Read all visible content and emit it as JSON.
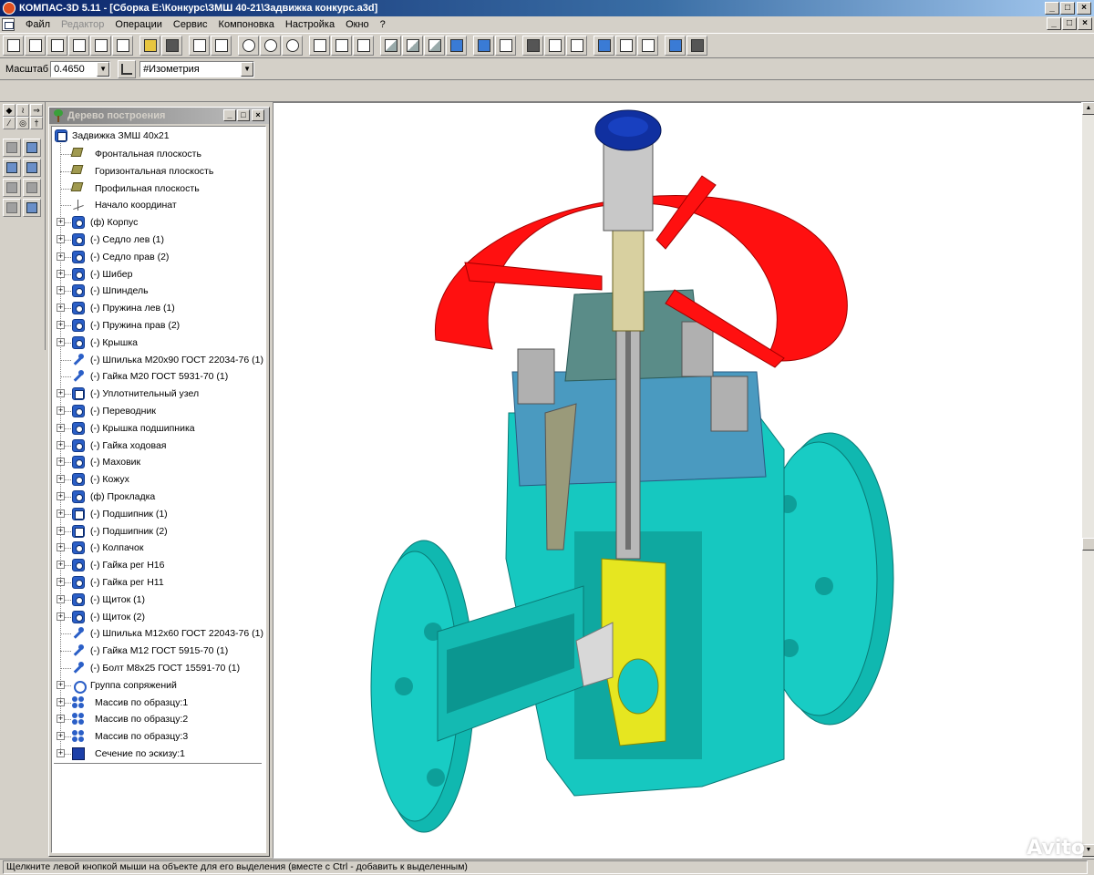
{
  "window": {
    "title": "КОМПАС-3D 5.11 - [Сборка E:\\Конкурс\\ЗМШ 40-21\\Задвижка конкурс.a3d]",
    "buttons": {
      "minimize": "_",
      "maximize": "□",
      "close": "×"
    }
  },
  "menu": {
    "items": [
      {
        "label": "Файл",
        "disabled": false
      },
      {
        "label": "Редактор",
        "disabled": true
      },
      {
        "label": "Операции",
        "disabled": false
      },
      {
        "label": "Сервис",
        "disabled": false
      },
      {
        "label": "Компоновка",
        "disabled": false
      },
      {
        "label": "Настройка",
        "disabled": false
      },
      {
        "label": "Окно",
        "disabled": false
      },
      {
        "label": "?",
        "disabled": false
      }
    ]
  },
  "toolbar": {
    "groups": [
      [
        "new-assembly-icon",
        "new-part-icon",
        "new-document-icon",
        "new-sheet-icon",
        "new-text-icon",
        "new-spec-icon"
      ],
      [
        "open-icon",
        "save-icon"
      ],
      [
        "cut-icon",
        "paste-icon"
      ],
      [
        "zoom-icon",
        "zoom-in-icon",
        "zoom-out-icon"
      ],
      [
        "pan-icon",
        "zoom-fit-icon",
        "rotate-icon"
      ],
      [
        "wireframe-icon",
        "hidden-lines-icon",
        "hidden-removed-icon",
        "shaded-icon"
      ],
      [
        "perspective-icon",
        "model-settings-icon"
      ],
      [
        "measure-icon",
        "sketch-icon",
        "section-view-icon"
      ],
      [
        "calculator-icon",
        "preview-icon",
        "properties-icon"
      ],
      [
        "help-icon",
        "exit-icon"
      ]
    ]
  },
  "propbar": {
    "scale_label": "Масштаб",
    "scale_value": "0.4650",
    "orientation_value": "#Изометрия"
  },
  "tree": {
    "caption": "Дерево построения",
    "root": "Задвижка ЗМШ 40х21",
    "items": [
      {
        "label": "Фронтальная плоскость",
        "icon": "plane",
        "expand": false
      },
      {
        "label": "Горизонтальная плоскость",
        "icon": "plane",
        "expand": false
      },
      {
        "label": "Профильная плоскость",
        "icon": "plane",
        "expand": false
      },
      {
        "label": "Начало координат",
        "icon": "origin",
        "expand": false
      },
      {
        "label": "(ф) Корпус",
        "icon": "part",
        "expand": true
      },
      {
        "label": "(-) Седло лев (1)",
        "icon": "part",
        "expand": true
      },
      {
        "label": "(-) Седло прав (2)",
        "icon": "part",
        "expand": true
      },
      {
        "label": "(-) Шибер",
        "icon": "part",
        "expand": true
      },
      {
        "label": "(-) Шпиндель",
        "icon": "part",
        "expand": true
      },
      {
        "label": "(-) Пружина лев (1)",
        "icon": "part",
        "expand": true
      },
      {
        "label": "(-) Пружина прав (2)",
        "icon": "part",
        "expand": true
      },
      {
        "label": "(-) Крышка",
        "icon": "part",
        "expand": true
      },
      {
        "label": "(-) Шпилька М20х90 ГОСТ 22034-76 (1)",
        "icon": "stud",
        "expand": false
      },
      {
        "label": "(-) Гайка М20 ГОСТ 5931-70 (1)",
        "icon": "stud",
        "expand": false
      },
      {
        "label": "(-) Уплотнительный узел",
        "icon": "asm",
        "expand": true
      },
      {
        "label": "(-) Переводник",
        "icon": "part",
        "expand": true
      },
      {
        "label": "(-) Крышка подшипника",
        "icon": "part",
        "expand": true
      },
      {
        "label": "(-) Гайка ходовая",
        "icon": "part",
        "expand": true
      },
      {
        "label": "(-) Маховик",
        "icon": "part",
        "expand": true
      },
      {
        "label": "(-) Кожух",
        "icon": "part",
        "expand": true
      },
      {
        "label": "(ф) Прокладка",
        "icon": "part",
        "expand": true
      },
      {
        "label": "(-) Подшипник (1)",
        "icon": "asm",
        "expand": true
      },
      {
        "label": "(-) Подшипник (2)",
        "icon": "asm",
        "expand": true
      },
      {
        "label": "(-) Колпачок",
        "icon": "part",
        "expand": true
      },
      {
        "label": "(-) Гайка рег Н16",
        "icon": "part",
        "expand": true
      },
      {
        "label": "(-) Гайка рег Н11",
        "icon": "part",
        "expand": true
      },
      {
        "label": "(-) Щиток (1)",
        "icon": "part",
        "expand": true
      },
      {
        "label": "(-) Щиток (2)",
        "icon": "part",
        "expand": true
      },
      {
        "label": "(-) Шпилька М12х60 ГОСТ 22043-76 (1)",
        "icon": "stud",
        "expand": false
      },
      {
        "label": "(-) Гайка М12 ГОСТ 5915-70 (1)",
        "icon": "stud",
        "expand": false
      },
      {
        "label": "(-) Болт М8х25 ГОСТ 15591-70 (1)",
        "icon": "stud",
        "expand": false
      },
      {
        "label": "Группа сопряжений",
        "icon": "mate",
        "expand": true
      },
      {
        "label": "Массив по образцу:1",
        "icon": "array",
        "expand": true
      },
      {
        "label": "Массив по образцу:2",
        "icon": "array",
        "expand": true
      },
      {
        "label": "Массив по образцу:3",
        "icon": "array",
        "expand": true
      },
      {
        "label": "Сечение по эскизу:1",
        "icon": "section",
        "expand": true
      }
    ]
  },
  "viewport": {
    "model": "gate-valve-section",
    "colors": {
      "handwheel": "#ff1010",
      "body": "#16c8c0",
      "bonnet": "#4a9ac0",
      "cap": "#1030a0",
      "gate": "#e0e020",
      "stem": "#b8b8b8",
      "nuts": "#b0b0b0",
      "seal": "#6a9a90"
    }
  },
  "status": {
    "text": "Щелкните левой кнопкой мыши на объекте для его выделения (вместе с Ctrl - добавить к выделенным)"
  },
  "watermark": "Avito"
}
